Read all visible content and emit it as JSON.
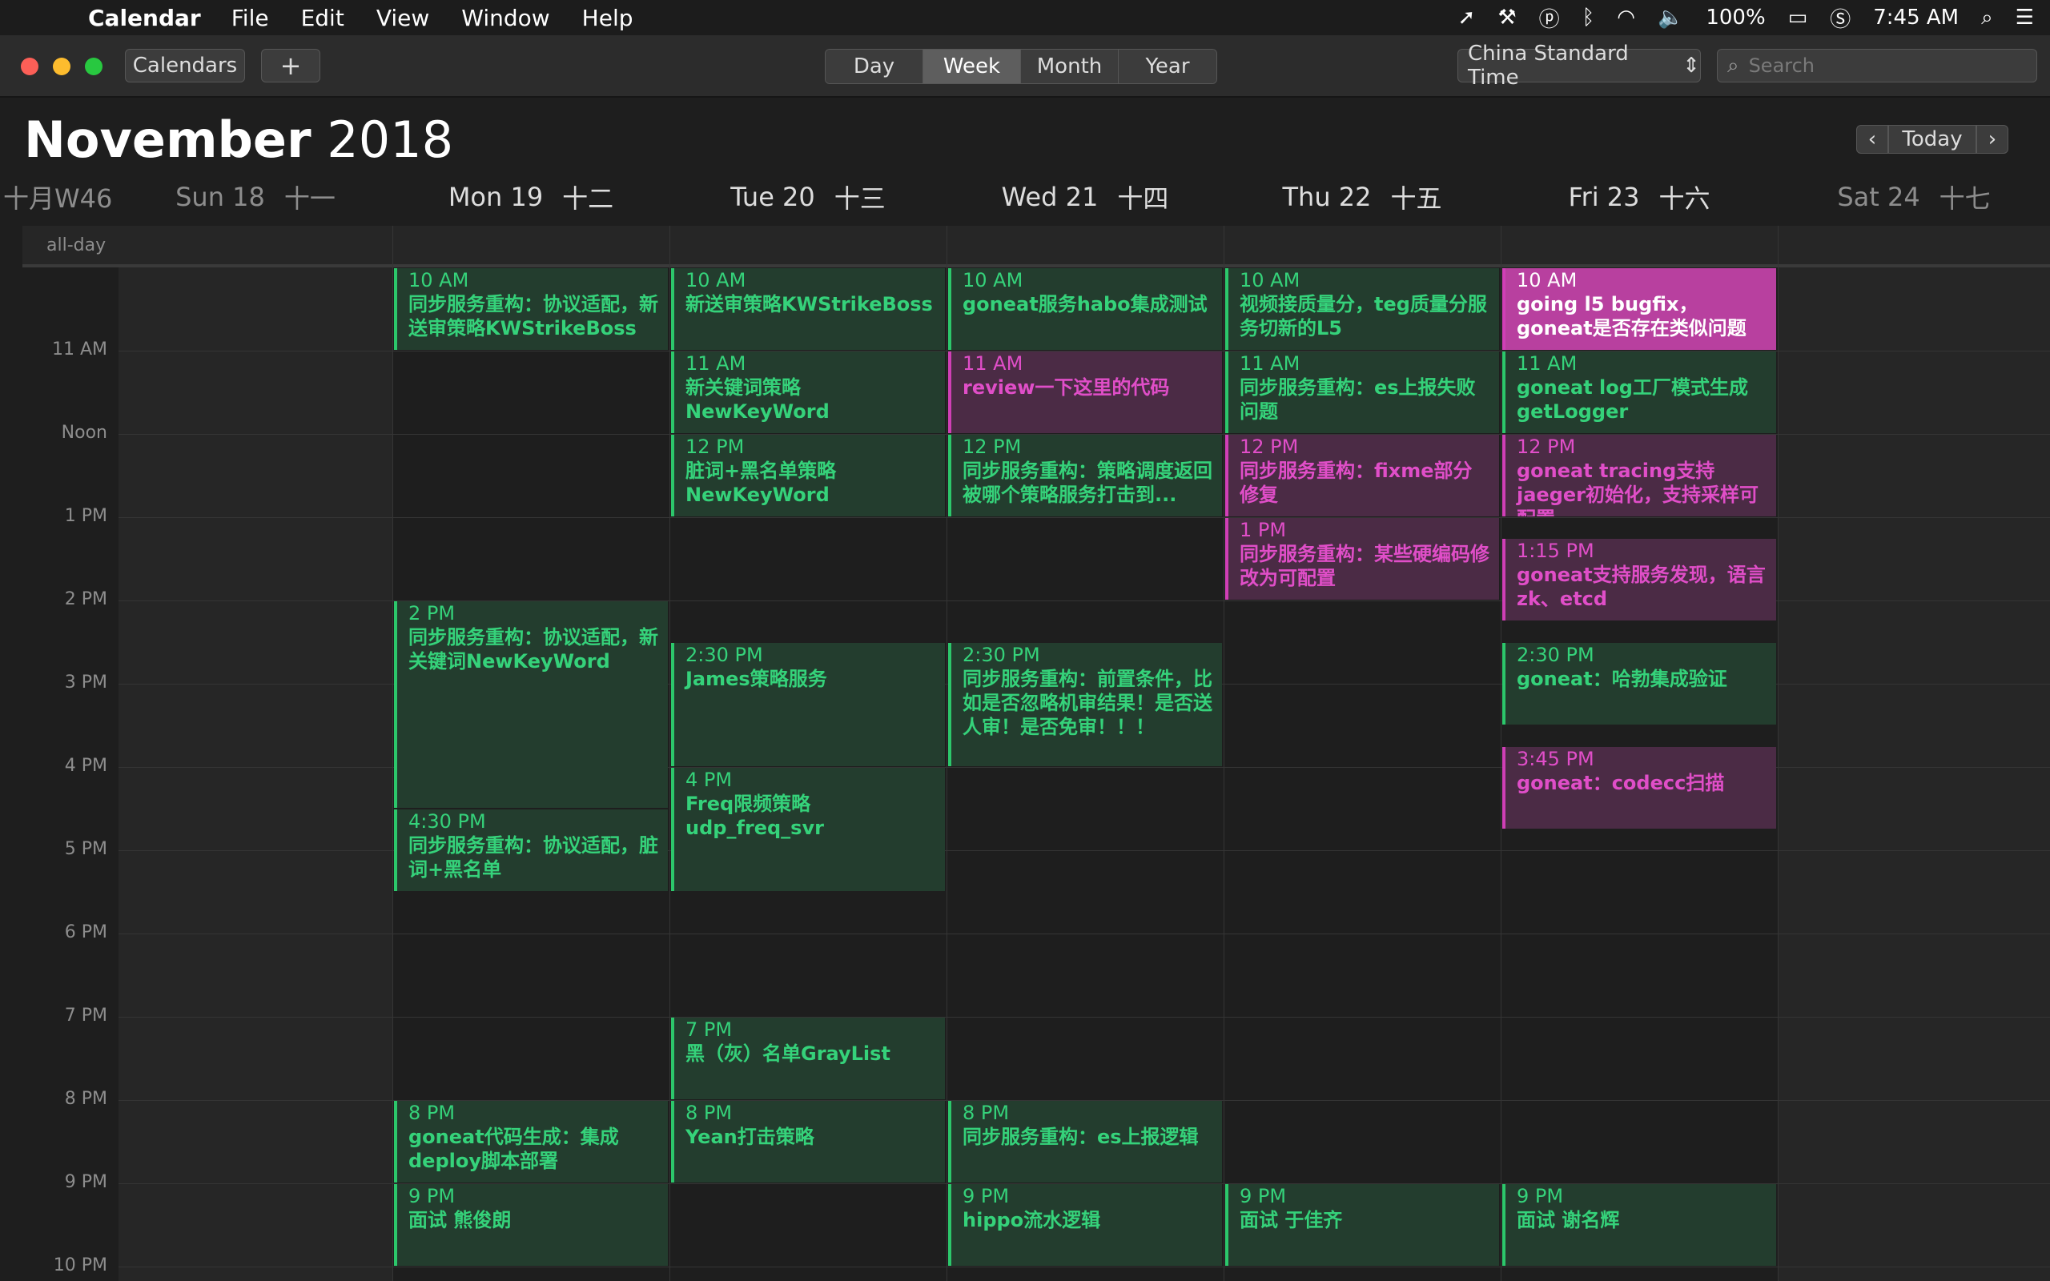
{
  "menubar": {
    "app": "Calendar",
    "items": [
      "File",
      "Edit",
      "View",
      "Window",
      "Help"
    ],
    "battery": "100%",
    "clock": "7:45 AM"
  },
  "toolbar": {
    "calendars_label": "Calendars",
    "add_label": "+",
    "views": [
      "Day",
      "Week",
      "Month",
      "Year"
    ],
    "active_view": "Week",
    "timezone": "China Standard Time",
    "search_placeholder": "Search"
  },
  "header": {
    "month": "November",
    "year": "2018",
    "today_label": "Today",
    "week_number": "十月W46",
    "days": [
      {
        "label": "Sun 18",
        "lunar": "十一",
        "weekend": true
      },
      {
        "label": "Mon 19",
        "lunar": "十二",
        "weekend": false
      },
      {
        "label": "Tue 20",
        "lunar": "十三",
        "weekend": false
      },
      {
        "label": "Wed 21",
        "lunar": "十四",
        "weekend": false
      },
      {
        "label": "Thu 22",
        "lunar": "十五",
        "weekend": false
      },
      {
        "label": "Fri 23",
        "lunar": "十六",
        "weekend": false
      },
      {
        "label": "Sat 24",
        "lunar": "十七",
        "weekend": true
      }
    ]
  },
  "allday_label": "all-day",
  "hours": [
    "11 AM",
    "Noon",
    "1 PM",
    "2 PM",
    "3 PM",
    "4 PM",
    "5 PM",
    "6 PM",
    "7 PM",
    "8 PM",
    "9 PM",
    "10 PM"
  ],
  "events": [
    {
      "day": 1,
      "start": 10.0,
      "end": 11.0,
      "time": "10 AM",
      "title": "同步服务重构：协议适配，新送审策略KWStrikeBoss",
      "color": "green"
    },
    {
      "day": 1,
      "start": 14.0,
      "end": 16.5,
      "time": "2 PM",
      "title": "同步服务重构：协议适配，新关键词NewKeyWord",
      "color": "green"
    },
    {
      "day": 1,
      "start": 16.5,
      "end": 17.5,
      "time": "4:30 PM",
      "title": "同步服务重构：协议适配，脏词+黑名单",
      "color": "green"
    },
    {
      "day": 1,
      "start": 20.0,
      "end": 21.0,
      "time": "8 PM",
      "title": "goneat代码生成：集成deploy脚本部署",
      "color": "green"
    },
    {
      "day": 1,
      "start": 21.0,
      "end": 22.0,
      "time": "9 PM",
      "title": "面试 熊俊朗",
      "color": "green"
    },
    {
      "day": 2,
      "start": 10.0,
      "end": 11.0,
      "time": "10 AM",
      "title": "新送审策略KWStrikeBoss",
      "color": "green"
    },
    {
      "day": 2,
      "start": 11.0,
      "end": 12.0,
      "time": "11 AM",
      "title": "新关键词策略NewKeyWord",
      "color": "green"
    },
    {
      "day": 2,
      "start": 12.0,
      "end": 13.0,
      "time": "12 PM",
      "title": "脏词+黑名单策略NewKeyWord",
      "color": "green"
    },
    {
      "day": 2,
      "start": 14.5,
      "end": 16.0,
      "time": "2:30 PM",
      "title": "James策略服务",
      "color": "green"
    },
    {
      "day": 2,
      "start": 16.0,
      "end": 17.5,
      "time": "4 PM",
      "title": "Freq限频策略udp_freq_svr",
      "color": "green"
    },
    {
      "day": 2,
      "start": 19.0,
      "end": 20.0,
      "time": "7 PM",
      "title": "黑（灰）名单GrayList",
      "color": "green"
    },
    {
      "day": 2,
      "start": 20.0,
      "end": 21.0,
      "time": "8 PM",
      "title": "Yean打击策略",
      "color": "green"
    },
    {
      "day": 3,
      "start": 10.0,
      "end": 11.0,
      "time": "10 AM",
      "title": "goneat服务habo集成测试",
      "color": "green"
    },
    {
      "day": 3,
      "start": 11.0,
      "end": 12.0,
      "time": "11 AM",
      "title": "review一下这里的代码",
      "color": "pink"
    },
    {
      "day": 3,
      "start": 12.0,
      "end": 13.0,
      "time": "12 PM",
      "title": "同步服务重构：策略调度返回被哪个策略服务打击到...",
      "color": "green"
    },
    {
      "day": 3,
      "start": 14.5,
      "end": 16.0,
      "time": "2:30 PM",
      "title": "同步服务重构：前置条件，比如是否忽略机审结果！是否送人审！是否免审！！！",
      "color": "green"
    },
    {
      "day": 3,
      "start": 20.0,
      "end": 21.0,
      "time": "8 PM",
      "title": "同步服务重构：es上报逻辑",
      "color": "green"
    },
    {
      "day": 3,
      "start": 21.0,
      "end": 22.0,
      "time": "9 PM",
      "title": "hippo流水逻辑",
      "color": "green"
    },
    {
      "day": 4,
      "start": 10.0,
      "end": 11.0,
      "time": "10 AM",
      "title": "视频接质量分，teg质量分服务切新的L5",
      "color": "green"
    },
    {
      "day": 4,
      "start": 11.0,
      "end": 12.0,
      "time": "11 AM",
      "title": "同步服务重构：es上报失败问题",
      "color": "green"
    },
    {
      "day": 4,
      "start": 12.0,
      "end": 13.0,
      "time": "12 PM",
      "title": "同步服务重构：fixme部分修复",
      "color": "pink"
    },
    {
      "day": 4,
      "start": 13.0,
      "end": 14.0,
      "time": "1 PM",
      "title": "同步服务重构：某些硬编码修改为可配置",
      "color": "pink"
    },
    {
      "day": 4,
      "start": 21.0,
      "end": 22.0,
      "time": "9 PM",
      "title": "面试 于佳齐",
      "color": "green"
    },
    {
      "day": 5,
      "start": 10.0,
      "end": 11.0,
      "time": "10 AM",
      "title": "going l5 bugfix，goneat是否存在类似问题",
      "color": "pinksel"
    },
    {
      "day": 5,
      "start": 11.0,
      "end": 12.0,
      "time": "11 AM",
      "title": "goneat log工厂模式生成getLogger",
      "color": "green"
    },
    {
      "day": 5,
      "start": 12.0,
      "end": 13.0,
      "time": "12 PM",
      "title": "goneat tracing支持jaeger初始化，支持采样可配置",
      "color": "pink"
    },
    {
      "day": 5,
      "start": 13.25,
      "end": 14.25,
      "time": "1:15 PM",
      "title": "goneat支持服务发现，语言zk、etcd",
      "color": "pink"
    },
    {
      "day": 5,
      "start": 14.5,
      "end": 15.5,
      "time": "2:30 PM",
      "title": "goneat：哈勃集成验证",
      "color": "green"
    },
    {
      "day": 5,
      "start": 15.75,
      "end": 16.75,
      "time": "3:45 PM",
      "title": "goneat：codecc扫描",
      "color": "pink"
    },
    {
      "day": 5,
      "start": 21.0,
      "end": 22.0,
      "time": "9 PM",
      "title": "面试 谢名辉",
      "color": "green"
    }
  ],
  "colors": {
    "green": "#35d27a",
    "pink": "#e04ec8",
    "selected": "#b8409f"
  }
}
